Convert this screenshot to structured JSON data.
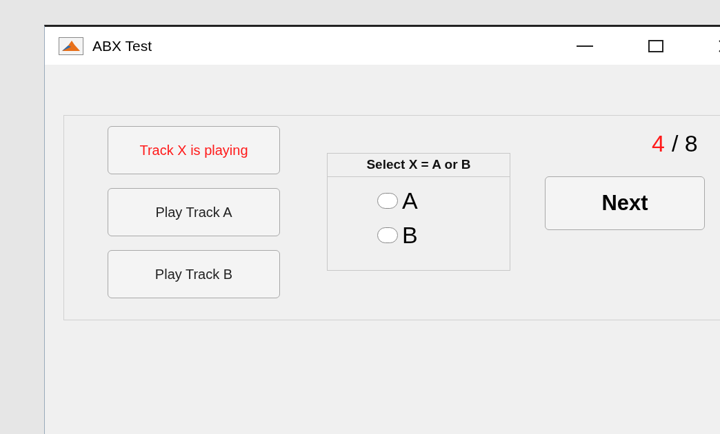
{
  "window": {
    "title": "ABX Test"
  },
  "track_buttons": [
    {
      "label": "Track X is playing",
      "playing": true
    },
    {
      "label": "Play Track A",
      "playing": false
    },
    {
      "label": "Play Track B",
      "playing": false
    }
  ],
  "selection": {
    "title": "Select X = A or B",
    "options": [
      {
        "label": "A",
        "selected": false
      },
      {
        "label": "B",
        "selected": false
      }
    ]
  },
  "counter": {
    "current": "4",
    "total": "/ 8"
  },
  "next_button": "Next"
}
